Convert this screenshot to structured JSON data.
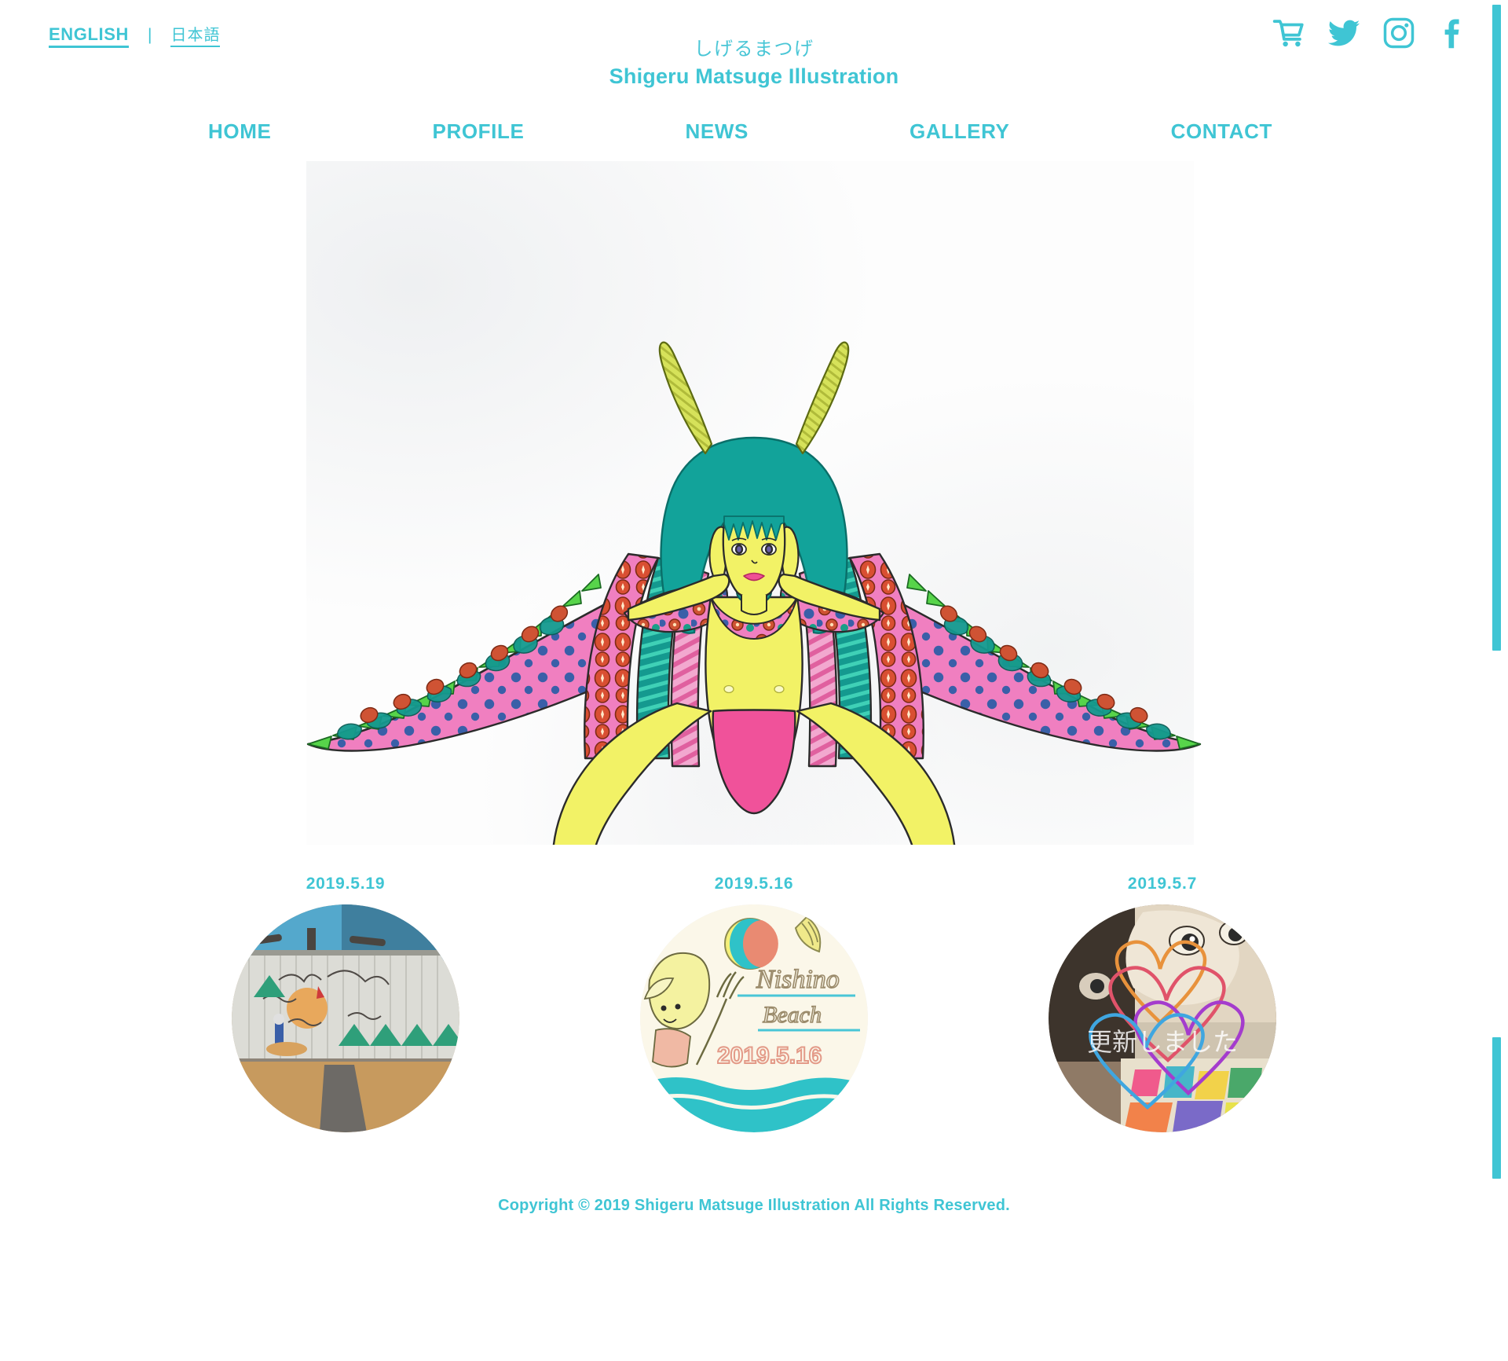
{
  "colors": {
    "accent": "#3fc5d4",
    "skin": "#f2f266",
    "hair": "#12a39a",
    "cape_pink": "#f07fc0",
    "cape_green": "#57d44a",
    "cape_teal": "#14998f",
    "cape_red": "#d94f32",
    "dot_blue": "#3a5fa8",
    "briefs_pink": "#f0529a",
    "lips": "#ef4f95",
    "background": "#ffffff"
  },
  "lang_switch": {
    "english_label": "ENGLISH",
    "separator": "|",
    "japanese_label": "日本語"
  },
  "header": {
    "title_jp": "しげるまつげ",
    "title_en": "Shigeru Matsuge Illustration"
  },
  "social": [
    {
      "name": "shopping-cart-icon",
      "label": "Shopping Cart"
    },
    {
      "name": "twitter-icon",
      "label": "Twitter"
    },
    {
      "name": "instagram-icon",
      "label": "Instagram"
    },
    {
      "name": "facebook-icon",
      "label": "Facebook"
    }
  ],
  "nav": {
    "items": [
      {
        "label": "HOME"
      },
      {
        "label": "PROFILE"
      },
      {
        "label": "NEWS"
      },
      {
        "label": "GALLERY"
      },
      {
        "label": "CONTACT"
      }
    ]
  },
  "hero": {
    "alt": "Illustration of a yellow-skinned winged figure with teal hair, antennae and a patterned pink cape"
  },
  "news": {
    "items": [
      {
        "date": "2019.5.19",
        "thumb_name": "news-thumb-mural",
        "description": "Mural painted on a corrugated metal fence with sky, sun face and green waves"
      },
      {
        "date": "2019.5.16",
        "thumb_name": "news-thumb-beach",
        "description": "Hand drawn beach scene with beach ball and sea",
        "drawing_text_line1": "Nishino",
        "drawing_text_line2": "Beach",
        "drawing_text_line3": "2019.5.16"
      },
      {
        "date": "2019.5.7",
        "thumb_name": "news-thumb-update",
        "description": "Photo with colourful hand drawn hearts",
        "overlay_text": "更新しました"
      }
    ]
  },
  "footer": {
    "copyright": "Copyright © 2019 Shigeru Matsuge Illustration All Rights Reserved."
  },
  "scrollbar": {
    "thumb_label": "vertical scrollbar thumb"
  }
}
